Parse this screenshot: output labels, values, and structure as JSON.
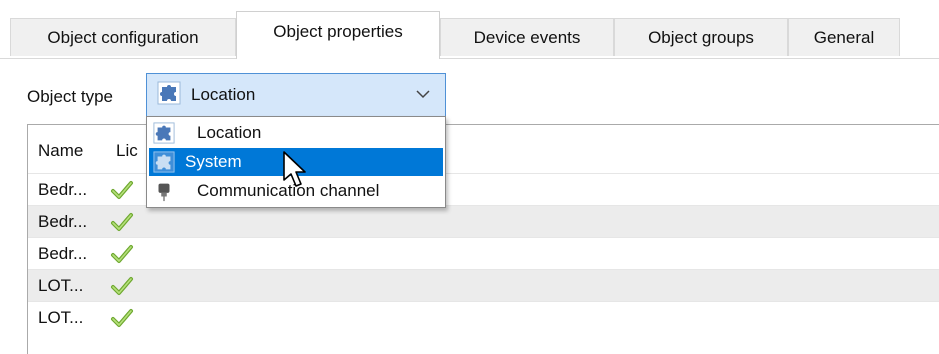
{
  "tabs": [
    {
      "label": "Object configuration",
      "active": false
    },
    {
      "label": "Object properties",
      "active": true
    },
    {
      "label": "Device events",
      "active": false
    },
    {
      "label": "Object groups",
      "active": false
    },
    {
      "label": "General",
      "active": false
    }
  ],
  "object_type": {
    "label": "Object type",
    "selected_value": "Location",
    "icon": "puzzle-icon",
    "options": [
      {
        "label": "Location",
        "icon": "puzzle-icon",
        "highlighted": false
      },
      {
        "label": "System",
        "icon": "puzzle-icon",
        "highlighted": true
      },
      {
        "label": "Communication channel",
        "icon": "plug-icon",
        "highlighted": false
      }
    ]
  },
  "grid": {
    "columns": [
      "Name",
      "Lic"
    ],
    "rows": [
      {
        "name": "Bedr...",
        "licensed_icon": "check-icon"
      },
      {
        "name": "Bedr...",
        "licensed_icon": "check-icon"
      },
      {
        "name": "Bedr...",
        "licensed_icon": "check-icon"
      },
      {
        "name": "LOT...",
        "licensed_icon": "check-icon"
      },
      {
        "name": "LOT...",
        "licensed_icon": "check-icon"
      }
    ]
  },
  "colors": {
    "selection": "#0078d7",
    "combo_fill": "#d5e7fa",
    "combo_border": "#4f91d6",
    "check": "#8cc63f",
    "alt_row": "#ececec"
  }
}
